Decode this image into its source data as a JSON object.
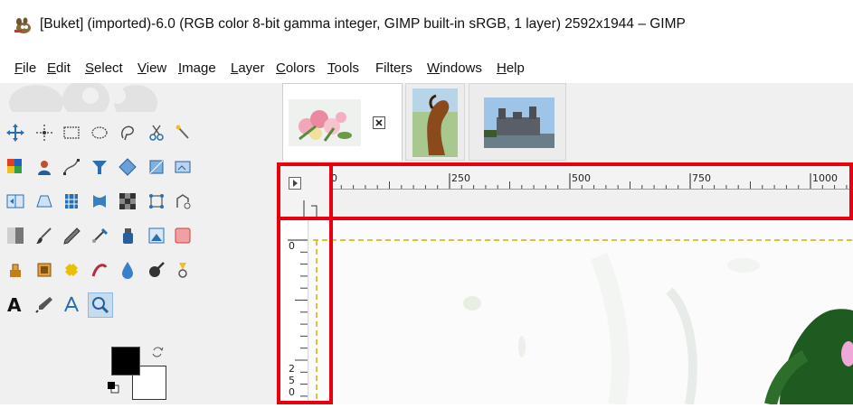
{
  "window": {
    "title": "[Buket] (imported)-6.0 (RGB color 8-bit gamma integer, GIMP built-in sRGB, 1 layer) 2592x1944 – GIMP",
    "app_icon": "gimp-wilber-icon"
  },
  "menubar": {
    "items": [
      {
        "pre": "",
        "ul": "F",
        "post": "ile"
      },
      {
        "pre": "",
        "ul": "E",
        "post": "dit"
      },
      {
        "pre": "",
        "ul": "S",
        "post": "elect"
      },
      {
        "pre": "",
        "ul": "V",
        "post": "iew"
      },
      {
        "pre": "",
        "ul": "I",
        "post": "mage"
      },
      {
        "pre": "",
        "ul": "L",
        "post": "ayer"
      },
      {
        "pre": "",
        "ul": "C",
        "post": "olors"
      },
      {
        "pre": "",
        "ul": "T",
        "post": "ools"
      },
      {
        "pre": "Filte",
        "ul": "r",
        "post": "s"
      },
      {
        "pre": "",
        "ul": "W",
        "post": "indows"
      },
      {
        "pre": "",
        "ul": "H",
        "post": "elp"
      }
    ]
  },
  "toolbox": {
    "active_tool": "zoom-tool",
    "foreground_color": "#000000",
    "background_color": "#ffffff"
  },
  "image_tabs": [
    {
      "name": "Buket",
      "active": true,
      "close_icon": "close-icon"
    },
    {
      "name": "Horse",
      "active": false
    },
    {
      "name": "Castle",
      "active": false
    }
  ],
  "rulers": {
    "horizontal_labels": [
      "0",
      "250",
      "500",
      "750",
      "1000"
    ],
    "vertical_labels": [
      "0",
      "2",
      "5",
      "0"
    ]
  },
  "highlights": {
    "color": "#e8000f"
  }
}
